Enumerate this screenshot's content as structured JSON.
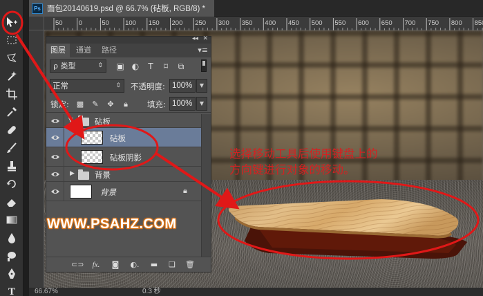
{
  "document": {
    "app_badge": "Ps",
    "tab_title": "面包20140619.psd @ 66.7% (砧板, RGB/8) *"
  },
  "ruler": {
    "ticks": [
      "50",
      "0",
      "50",
      "100",
      "150",
      "200",
      "250",
      "300",
      "350",
      "400",
      "450",
      "500",
      "550",
      "600",
      "650",
      "700",
      "750",
      "800",
      "850"
    ]
  },
  "toolbar": {
    "tools": [
      "move-tool",
      "marquee-tool",
      "lasso-tool",
      "magic-wand-tool",
      "crop-tool",
      "eyedropper-tool",
      "healing-brush-tool",
      "brush-tool",
      "clone-stamp-tool",
      "history-brush-tool",
      "eraser-tool",
      "gradient-tool",
      "blur-tool",
      "dodge-tool",
      "pen-tool",
      "type-tool"
    ]
  },
  "layers_panel": {
    "tabs": [
      "图层",
      "通道",
      "路径"
    ],
    "active_tab": "图层",
    "filter_label": "ρ 类型",
    "blend_mode": "正常",
    "opacity_label": "不透明度:",
    "opacity_value": "100%",
    "lock_label": "锁定:",
    "fill_label": "填充:",
    "fill_value": "100%",
    "layers": [
      {
        "name": "砧板",
        "kind": "group",
        "expanded": true,
        "visible": true
      },
      {
        "name": "砧板",
        "kind": "layer",
        "selected": true,
        "visible": true
      },
      {
        "name": "砧板阴影",
        "kind": "layer",
        "visible": true
      },
      {
        "name": "背景",
        "kind": "group",
        "expanded": false,
        "visible": true
      },
      {
        "name": "背景",
        "kind": "background",
        "visible": true,
        "locked": true
      }
    ],
    "footer_icons": [
      "link-icon",
      "fx-icon",
      "mask-icon",
      "adjustment-icon",
      "new-group-icon",
      "new-layer-icon",
      "trash-icon"
    ]
  },
  "annotation": {
    "line1": "选择移动工具后使用键盘上的",
    "line2": "方向键进行对象的移动。"
  },
  "watermark": "WWW.PSAHZ.COM",
  "status": {
    "zoom": "66.67%",
    "timing": "0.3 秒"
  },
  "colors": {
    "annotation_red": "#d22222",
    "selection_blue": "#6a7c99",
    "watermark_glow": "#e07a18"
  }
}
